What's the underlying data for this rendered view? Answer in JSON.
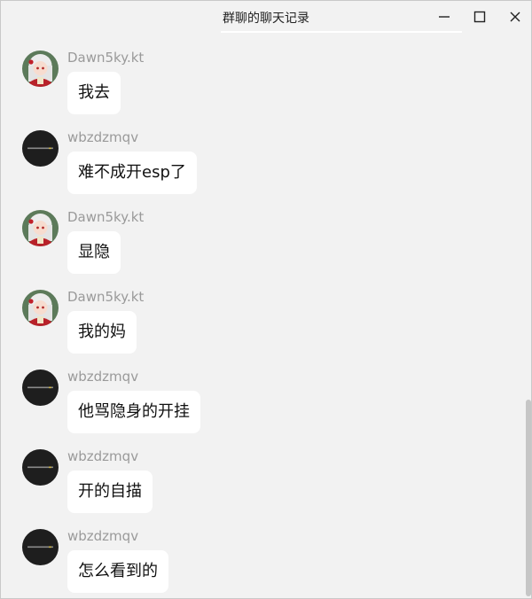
{
  "window": {
    "title": "群聊的聊天记录"
  },
  "messages": [
    {
      "sender": "Dawn5ky.kt",
      "text": "我去",
      "avatar": "anime-girl-avatar"
    },
    {
      "sender": "wbzdzmqv",
      "text": "难不成开esp了",
      "avatar": "dark-avatar"
    },
    {
      "sender": "Dawn5ky.kt",
      "text": "显隐",
      "avatar": "anime-girl-avatar"
    },
    {
      "sender": "Dawn5ky.kt",
      "text": "我的妈",
      "avatar": "anime-girl-avatar"
    },
    {
      "sender": "wbzdzmqv",
      "text": "他骂隐身的开挂",
      "avatar": "dark-avatar"
    },
    {
      "sender": "wbzdzmqv",
      "text": "开的自描",
      "avatar": "dark-avatar"
    },
    {
      "sender": "wbzdzmqv",
      "text": "怎么看到的",
      "avatar": "dark-avatar"
    }
  ],
  "colors": {
    "background": "#f2f2f2",
    "bubble": "#ffffff",
    "sender_name": "#9a9a9a"
  }
}
